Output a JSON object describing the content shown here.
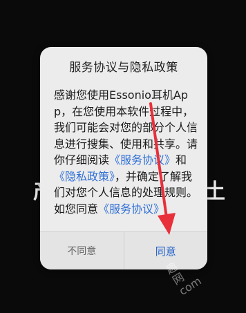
{
  "background": {
    "left_text": "产",
    "right_text": "土"
  },
  "dialog": {
    "title": "服务协议与隐私政策",
    "body_parts": [
      {
        "text": "感谢您使用Essonio耳机App，在您使用本软件过程中，我们可能会对您的部分个人信息进行搜集、使用和共享。请你仔细阅读"
      },
      {
        "text": "《服务协议》",
        "link": true
      },
      {
        "text": "和"
      },
      {
        "text": "《隐私政策》",
        "link": true
      },
      {
        "text": "，并确定了解我们对您个人信息的处理规则。如您同意"
      },
      {
        "text": "《服务协议》",
        "link": true
      }
    ],
    "buttons": {
      "disagree": "不同意",
      "agree": "同意"
    }
  },
  "watermark": {
    "lines": [
      "趣",
      "网",
      "com"
    ]
  },
  "colors": {
    "link": "#2f6fd6",
    "agree": "#1f5fc9",
    "arrow": "#e8303a"
  }
}
